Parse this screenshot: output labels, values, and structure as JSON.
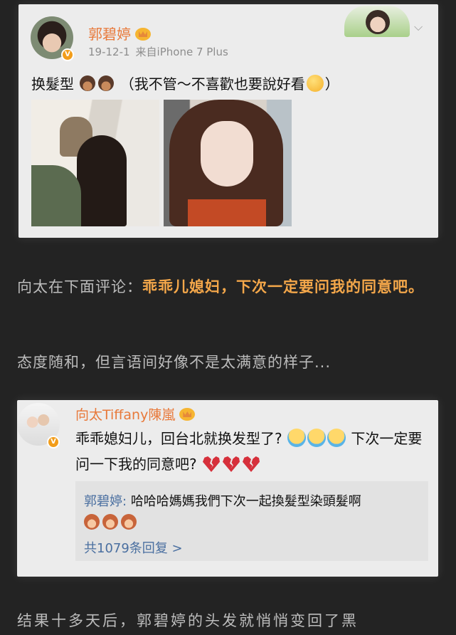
{
  "post": {
    "author": "郭碧婷",
    "time": "19-12-1",
    "source": "来自iPhone 7 Plus",
    "verified_badge": "V",
    "text_before": "换髮型",
    "text_after": "（我不管～不喜歡也要說好看",
    "text_end": "）",
    "icons": [
      "crown-icon",
      "emoji-face-icon",
      "yum-emoji-icon",
      "chevron-down-icon"
    ]
  },
  "caption1": {
    "prefix": "向太在下面评论：",
    "highlight": "乖乖儿媳妇，下次一定要问我的同意吧。"
  },
  "caption2": "态度随和，但言语间好像不是太满意的样子...",
  "comment": {
    "author": "向太Tiffany陳嵐",
    "verified_badge": "V",
    "text_part1": "乖乖媳妇儿，回台北就换发型了?",
    "text_part2": "下次一定要问一下我的同意吧?",
    "subreply": {
      "author": "郭碧婷:",
      "text": "哈哈哈媽媽我們下次一起換髮型染頭髮啊",
      "more": "共1079条回复 >"
    }
  },
  "caption3": "结果十多天后，郭碧婷的头发就悄悄变回了黑",
  "colors": {
    "background": "#232323",
    "card": "#ececec",
    "username": "#e8793a",
    "highlight": "#f4a74a",
    "link": "#4a6fa0"
  }
}
